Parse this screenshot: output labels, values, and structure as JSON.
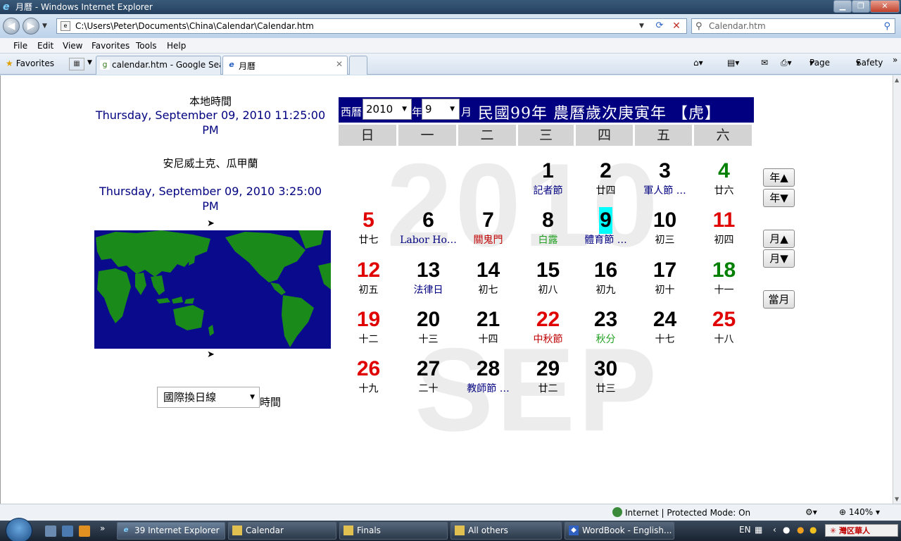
{
  "window": {
    "title": "月曆 - Windows Internet Explorer"
  },
  "address": {
    "url": "C:\\Users\\Peter\\Documents\\China\\Calendar\\Calendar.htm",
    "search_placeholder": "Calendar.htm"
  },
  "menu": [
    "File",
    "Edit",
    "View",
    "Favorites",
    "Tools",
    "Help"
  ],
  "favorites_label": "Favorites",
  "tabs": [
    {
      "label": "calendar.htm - Google Sea..."
    },
    {
      "label": "月曆"
    }
  ],
  "command_bar": {
    "page": "Page",
    "safety": "Safety"
  },
  "left_panel": {
    "local_label": "本地時間",
    "local_time": "Thursday, September 09, 2010 11:25:00 PM",
    "city_label": "安尼威土克、瓜甲蘭",
    "city_time": "Thursday, September 09, 2010 3:25:00 PM",
    "timezone_selected": "國際換日線",
    "timezone_suffix": "時間"
  },
  "calendar": {
    "west_label": "西曆",
    "year": "2010",
    "year_suffix": "年",
    "month": "9",
    "month_suffix": "月",
    "title": "民國99年  農曆歲次庚寅年  【虎】",
    "watermark_year": "2010",
    "watermark_month": "SEP",
    "weekdays": [
      "日",
      "一",
      "二",
      "三",
      "四",
      "五",
      "六"
    ],
    "days": [
      {
        "d": "1",
        "lunar": "記者節",
        "dc": "black",
        "lc": "blue"
      },
      {
        "d": "2",
        "lunar": "廿四",
        "dc": "black",
        "lc": "black"
      },
      {
        "d": "3",
        "lunar": "軍人節 …",
        "dc": "black",
        "lc": "blue"
      },
      {
        "d": "4",
        "lunar": "廿六",
        "dc": "green",
        "lc": "black"
      },
      {
        "d": "5",
        "lunar": "廿七",
        "dc": "red",
        "lc": "black"
      },
      {
        "d": "6",
        "lunar": "Labor Ho…",
        "dc": "black",
        "lc": "blue"
      },
      {
        "d": "7",
        "lunar": "關鬼門",
        "dc": "black",
        "lc": "red"
      },
      {
        "d": "8",
        "lunar": "白露",
        "dc": "black",
        "lc": "green"
      },
      {
        "d": "9",
        "lunar": "體育節 …",
        "dc": "black",
        "lc": "blue",
        "today": true
      },
      {
        "d": "10",
        "lunar": "初三",
        "dc": "black",
        "lc": "black"
      },
      {
        "d": "11",
        "lunar": "初四",
        "dc": "red",
        "lc": "black"
      },
      {
        "d": "12",
        "lunar": "初五",
        "dc": "red",
        "lc": "black"
      },
      {
        "d": "13",
        "lunar": "法律日",
        "dc": "black",
        "lc": "blue"
      },
      {
        "d": "14",
        "lunar": "初七",
        "dc": "black",
        "lc": "black"
      },
      {
        "d": "15",
        "lunar": "初八",
        "dc": "black",
        "lc": "black"
      },
      {
        "d": "16",
        "lunar": "初九",
        "dc": "black",
        "lc": "black"
      },
      {
        "d": "17",
        "lunar": "初十",
        "dc": "black",
        "lc": "black"
      },
      {
        "d": "18",
        "lunar": "十一",
        "dc": "green",
        "lc": "black"
      },
      {
        "d": "19",
        "lunar": "十二",
        "dc": "red",
        "lc": "black"
      },
      {
        "d": "20",
        "lunar": "十三",
        "dc": "black",
        "lc": "black"
      },
      {
        "d": "21",
        "lunar": "十四",
        "dc": "black",
        "lc": "black"
      },
      {
        "d": "22",
        "lunar": "中秋節",
        "dc": "red",
        "lc": "red"
      },
      {
        "d": "23",
        "lunar": "秋分",
        "dc": "black",
        "lc": "green"
      },
      {
        "d": "24",
        "lunar": "十七",
        "dc": "black",
        "lc": "black"
      },
      {
        "d": "25",
        "lunar": "十八",
        "dc": "red",
        "lc": "black"
      },
      {
        "d": "26",
        "lunar": "十九",
        "dc": "red",
        "lc": "black"
      },
      {
        "d": "27",
        "lunar": "二十",
        "dc": "black",
        "lc": "black"
      },
      {
        "d": "28",
        "lunar": "教師節 …",
        "dc": "black",
        "lc": "blue"
      },
      {
        "d": "29",
        "lunar": "廿二",
        "dc": "black",
        "lc": "black"
      },
      {
        "d": "30",
        "lunar": "廿三",
        "dc": "black",
        "lc": "black"
      }
    ],
    "first_weekday": 3,
    "buttons": {
      "year_up": "年▲",
      "year_down": "年▼",
      "month_up": "月▲",
      "month_down": "月▼",
      "current": "當月"
    }
  },
  "status": {
    "zone": "Internet | Protected Mode: On",
    "zoom": "140%"
  },
  "taskbar": {
    "items": [
      "39 Internet Explorer",
      "Calendar",
      "Finals",
      "All others",
      "WordBook - English..."
    ],
    "lang": "EN",
    "badge": "灣区華人"
  },
  "colors": {
    "header_bg": "#000080",
    "map_ocean": "#0a0a8c",
    "map_land": "#1a8a1a",
    "today_highlight": "#00ffff"
  }
}
